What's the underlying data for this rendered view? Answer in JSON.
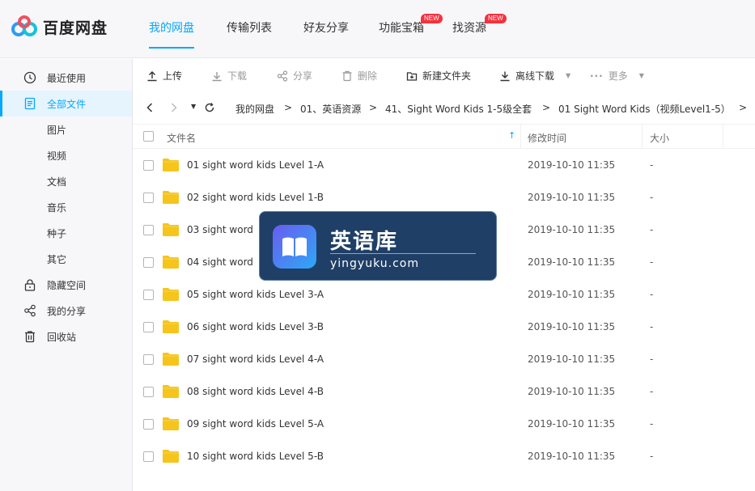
{
  "app": {
    "name": "百度网盘"
  },
  "nav": {
    "tabs": [
      {
        "label": "我的网盘",
        "active": true
      },
      {
        "label": "传输列表"
      },
      {
        "label": "好友分享"
      },
      {
        "label": "功能宝箱",
        "badge": "NEW"
      },
      {
        "label": "找资源",
        "badge": "NEW"
      }
    ]
  },
  "sidebar": {
    "items": [
      {
        "label": "最近使用",
        "icon": "clock-icon"
      },
      {
        "label": "全部文件",
        "icon": "document-icon",
        "active": true
      },
      {
        "label": "图片"
      },
      {
        "label": "视频"
      },
      {
        "label": "文档"
      },
      {
        "label": "音乐"
      },
      {
        "label": "种子"
      },
      {
        "label": "其它"
      },
      {
        "label": "隐藏空间",
        "icon": "lock-icon"
      },
      {
        "label": "我的分享",
        "icon": "share-icon"
      },
      {
        "label": "回收站",
        "icon": "trash-icon"
      }
    ]
  },
  "toolbar": {
    "upload": "上传",
    "download": "下载",
    "share": "分享",
    "delete": "删除",
    "new_folder": "新建文件夹",
    "offline_download": "离线下载",
    "more": "更多"
  },
  "breadcrumb": {
    "items": [
      "我的网盘",
      "01、英语资源",
      "41、Sight Word Kids 1-5级全套",
      "01 Sight Word Kids（视频Level1-5）"
    ],
    "separator": ">"
  },
  "table": {
    "headers": {
      "name": "文件名",
      "modified": "修改时间",
      "size": "大小"
    },
    "rows": [
      {
        "name": "01 sight word kids Level 1-A",
        "modified": "2019-10-10 11:35",
        "size": "-"
      },
      {
        "name": "02 sight word kids Level 1-B",
        "modified": "2019-10-10 11:35",
        "size": "-"
      },
      {
        "name": "03 sight word",
        "modified": "2019-10-10 11:35",
        "size": "-"
      },
      {
        "name": "04 sight word",
        "modified": "2019-10-10 11:35",
        "size": "-"
      },
      {
        "name": "05 sight word kids Level 3-A",
        "modified": "2019-10-10 11:35",
        "size": "-"
      },
      {
        "name": "06 sight word kids Level 3-B",
        "modified": "2019-10-10 11:35",
        "size": "-"
      },
      {
        "name": "07 sight word kids Level 4-A",
        "modified": "2019-10-10 11:35",
        "size": "-"
      },
      {
        "name": "08 sight word kids Level 4-B",
        "modified": "2019-10-10 11:35",
        "size": "-"
      },
      {
        "name": "09 sight word kids Level 5-A",
        "modified": "2019-10-10 11:35",
        "size": "-"
      },
      {
        "name": "10 sight word kids Level 5-B",
        "modified": "2019-10-10 11:35",
        "size": "-"
      }
    ]
  },
  "watermark": {
    "title": "英语库",
    "url": "yingyuku.com"
  },
  "colors": {
    "accent": "#06a7ff",
    "folder": "#f5c51b",
    "badge": "#f5313e",
    "sidebar_bg": "#f7f7f9"
  }
}
